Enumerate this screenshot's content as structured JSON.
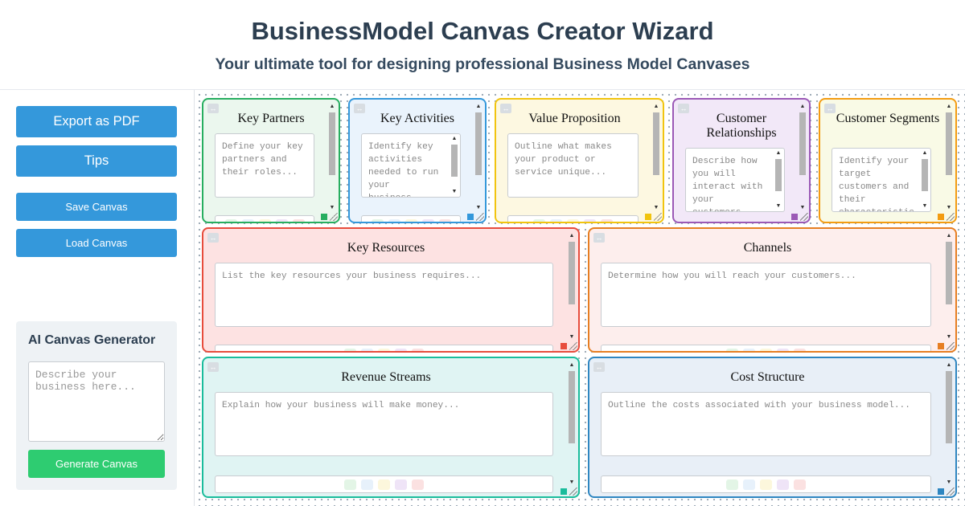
{
  "header": {
    "title": "BusinessModel Canvas Creator Wizard",
    "subtitle": "Your ultimate tool for designing professional Business Model Canvases"
  },
  "sidebar": {
    "export_label": "Export as PDF",
    "tips_label": "Tips",
    "save_label": "Save Canvas",
    "load_label": "Load Canvas"
  },
  "ai_generator": {
    "title": "AI Canvas Generator",
    "placeholder": "Describe your business here...",
    "button_label": "Generate Canvas"
  },
  "drag_glyph": "↔",
  "scroll_up_glyph": "▲",
  "scroll_down_glyph": "▼",
  "swatch_colors": [
    "#e3f5e6",
    "#e7f1fb",
    "#fcf7dc",
    "#efe4f7",
    "#fbe1e1"
  ],
  "blocks": {
    "key_partners": {
      "title": "Key Partners",
      "placeholder": "Define your key partners and their roles...",
      "accent": "#27ae60",
      "background": "#ebf7ee"
    },
    "key_activities": {
      "title": "Key Activities",
      "placeholder": "Identify key activities needed to run your business...",
      "accent": "#3498db",
      "background": "#eaf3fc"
    },
    "value_proposition": {
      "title": "Value Proposition",
      "placeholder": "Outline what makes your product or service unique...",
      "accent": "#f1c40f",
      "background": "#fdf8e1"
    },
    "customer_relationships": {
      "title": "Customer Relationships",
      "placeholder": "Describe how you will interact with your customers...",
      "accent": "#9b59b6",
      "background": "#f2e8f8"
    },
    "customer_segments": {
      "title": "Customer Segments",
      "placeholder": "Identify your target customers and their characteristics...",
      "accent": "#f39c12",
      "background": "#f9fae6"
    },
    "key_resources": {
      "title": "Key Resources",
      "placeholder": "List the key resources your business requires...",
      "accent": "#e74c3c",
      "background": "#fde2e2"
    },
    "channels": {
      "title": "Channels",
      "placeholder": "Determine how you will reach your customers...",
      "accent": "#e67e22",
      "background": "#fdeeed"
    },
    "revenue_streams": {
      "title": "Revenue Streams",
      "placeholder": "Explain how your business will make money...",
      "accent": "#1abc9c",
      "background": "#e0f4f3"
    },
    "cost_structure": {
      "title": "Cost Structure",
      "placeholder": "Outline the costs associated with your business model...",
      "accent": "#2e86c1",
      "background": "#e8eff7"
    }
  }
}
